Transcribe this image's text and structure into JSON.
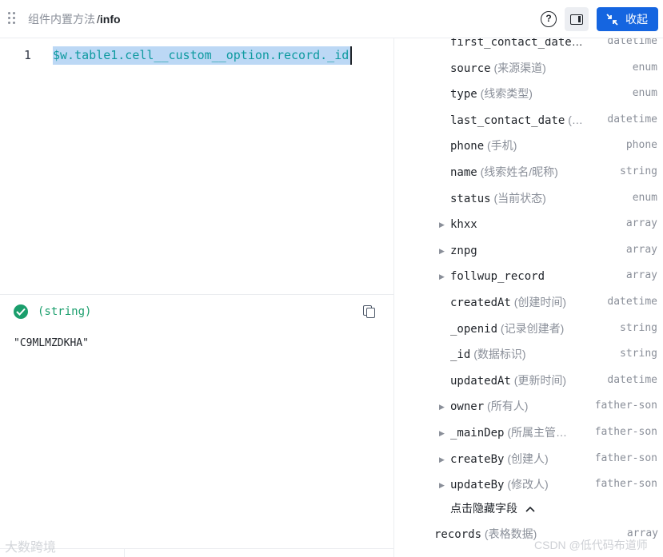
{
  "header": {
    "breadcrumb_parent": "组件内置方法",
    "breadcrumb_sep": "/",
    "breadcrumb_current": "info",
    "help_icon": "question-circle-icon",
    "help_glyph": "?",
    "panel_icon": "sidebar-right-icon",
    "collapse_icon": "shrink-arrows-icon",
    "collapse_label": "收起"
  },
  "editor": {
    "line_number": "1",
    "code": "$w.table1.cell__custom__option.record._id"
  },
  "result": {
    "status_icon": "check-circle-icon",
    "type": "(string)",
    "value": "\"C9MLMZDKHA\"",
    "copy_icon": "copy-icon"
  },
  "fields": [
    {
      "key": "first_contact_date",
      "desc": "(…",
      "type": "datetime",
      "expandable": false
    },
    {
      "key": "source",
      "desc": "(来源渠道)",
      "type": "enum",
      "expandable": false
    },
    {
      "key": "type",
      "desc": "(线索类型)",
      "type": "enum",
      "expandable": false
    },
    {
      "key": "last_contact_date",
      "desc": "(…",
      "type": "datetime",
      "expandable": false
    },
    {
      "key": "phone",
      "desc": "(手机)",
      "type": "phone",
      "expandable": false
    },
    {
      "key": "name",
      "desc": "(线索姓名/昵称)",
      "type": "string",
      "expandable": false
    },
    {
      "key": "status",
      "desc": "(当前状态)",
      "type": "enum",
      "expandable": false
    },
    {
      "key": "khxx",
      "desc": "",
      "type": "array",
      "expandable": true
    },
    {
      "key": "znpg",
      "desc": "",
      "type": "array",
      "expandable": true
    },
    {
      "key": "follwup_record",
      "desc": "",
      "type": "array",
      "expandable": true
    },
    {
      "key": "createdAt",
      "desc": "(创建时间)",
      "type": "datetime",
      "expandable": false
    },
    {
      "key": "_openid",
      "desc": "(记录创建者)",
      "type": "string",
      "expandable": false
    },
    {
      "key": "_id",
      "desc": "(数据标识)",
      "type": "string",
      "expandable": false
    },
    {
      "key": "updatedAt",
      "desc": "(更新时间)",
      "type": "datetime",
      "expandable": false
    },
    {
      "key": "owner",
      "desc": "(所有人)",
      "type": "father-son",
      "expandable": true
    },
    {
      "key": "_mainDep",
      "desc": "(所属主管…",
      "type": "father-son",
      "expandable": true
    },
    {
      "key": "createBy",
      "desc": "(创建人)",
      "type": "father-son",
      "expandable": true
    },
    {
      "key": "updateBy",
      "desc": "(修改人)",
      "type": "father-son",
      "expandable": true
    }
  ],
  "caret_glyph": "▶",
  "hidden_fields_toggle": "点击隐藏字段",
  "hidden_fields_chevron": "chevron-up-icon",
  "records": {
    "key": "records",
    "desc": "(表格数据)",
    "type": "array"
  },
  "watermark_left": "大数跨境",
  "watermark_right": "CSDN @低代码布道师"
}
